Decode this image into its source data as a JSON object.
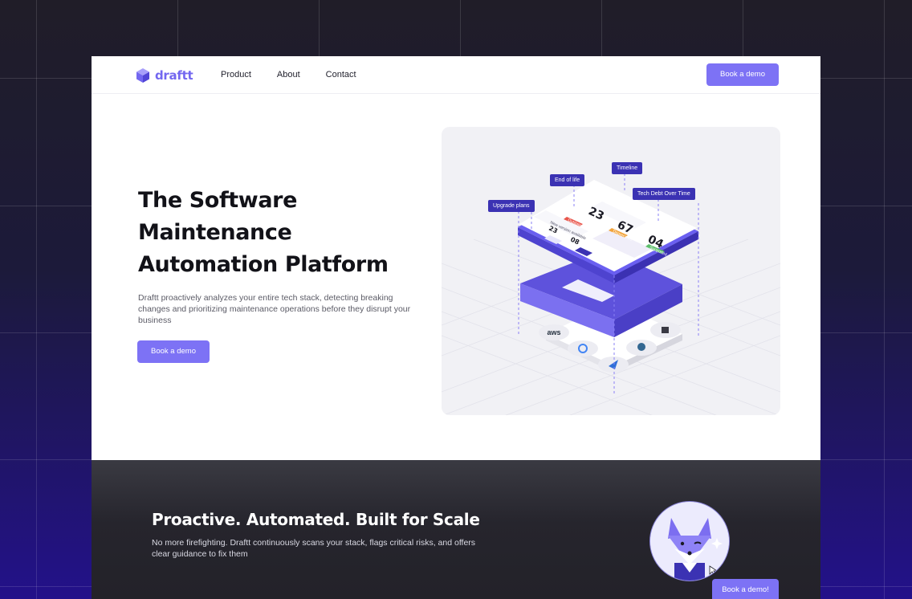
{
  "brand": {
    "name": "draftt",
    "color": "#7367f0"
  },
  "nav": {
    "links": [
      "Product",
      "About",
      "Contact"
    ],
    "cta": "Book a demo"
  },
  "hero": {
    "title": "The Software Maintenance Automation Platform",
    "description": "Draftt proactively analyzes your entire tech stack, detecting breaking changes and prioritizing maintenance operations before they disrupt your business",
    "cta": "Book a demo"
  },
  "illustration": {
    "callouts": [
      "End of life",
      "Timeline",
      "Upgrade plans",
      "Tech Debt Over Time"
    ],
    "card_numbers": [
      "23",
      "67",
      "04",
      "23",
      "08"
    ],
    "card_tags": [
      "Outdated",
      "Deprecated",
      "Supported"
    ],
    "card_text": "New version available",
    "integrations": [
      "aws-logo",
      "google-cloud-logo",
      "azure-logo",
      "postgresql-logo",
      "terraform-logo"
    ]
  },
  "section": {
    "title": "Proactive. Automated. Built for Scale",
    "description": "No more firefighting. Draftt continuously scans your stack, flags critical risks, and offers clear guidance to fix them",
    "cta": "Book a demo!"
  },
  "colors": {
    "accent": "#7d72f5",
    "callout_bg": "#3b32b3",
    "dark_section": "#26252d",
    "tag_red": "#e8554b",
    "tag_orange": "#f2a33a",
    "tag_green": "#5cbf6a"
  }
}
